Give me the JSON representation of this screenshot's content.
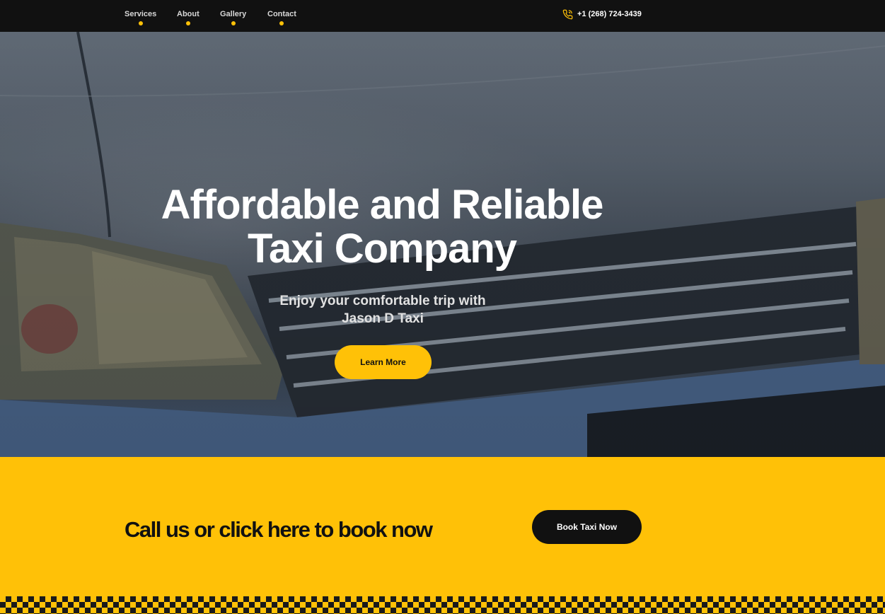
{
  "nav": {
    "items": [
      {
        "label": "Services"
      },
      {
        "label": "About"
      },
      {
        "label": "Gallery"
      },
      {
        "label": "Contact"
      }
    ],
    "phone": "+1 (268) 724-3439"
  },
  "hero": {
    "title_line1": "Affordable and Reliable",
    "title_line2": "Taxi Company",
    "subtitle_line1": "Enjoy your comfortable trip with",
    "subtitle_line2": "Jason D Taxi",
    "cta_label": "Learn More"
  },
  "booking": {
    "text": "Call us or click here to book now",
    "button_label": "Book Taxi Now"
  },
  "colors": {
    "accent": "#ffc107",
    "dark": "#111111",
    "white": "#ffffff"
  }
}
